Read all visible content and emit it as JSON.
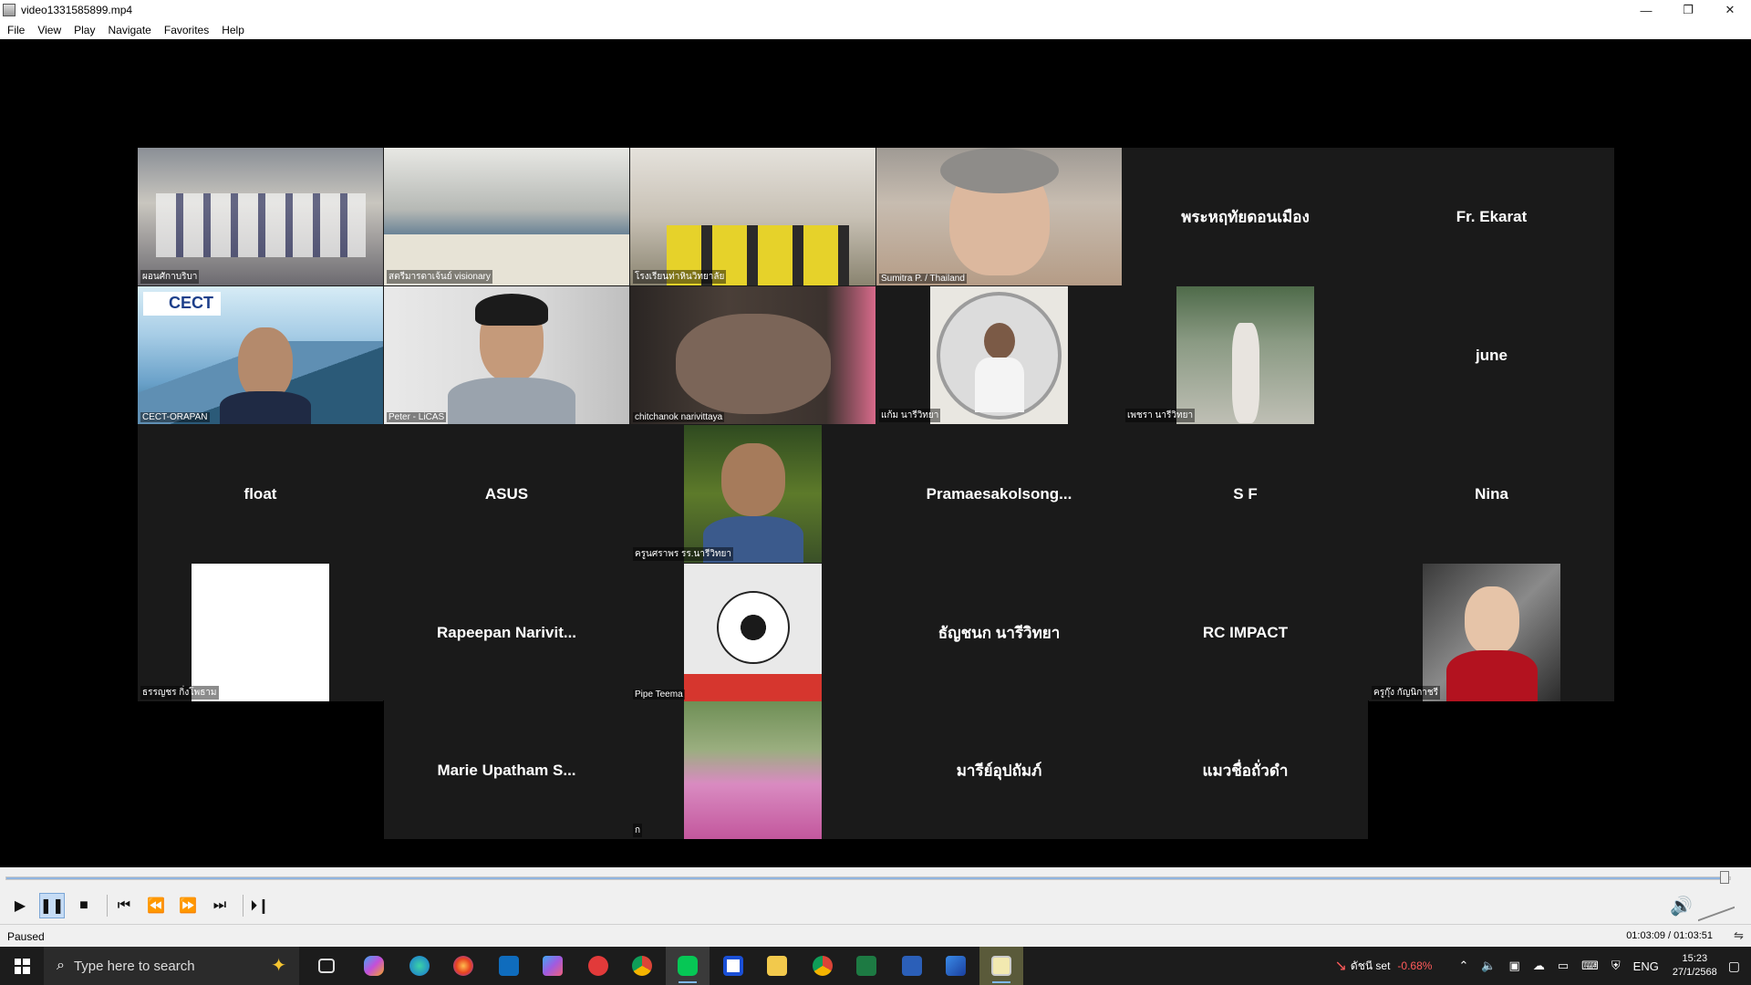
{
  "window": {
    "title": "video1331585899.mp4",
    "controls": {
      "minimize": "—",
      "restore": "❐",
      "close": "✕"
    }
  },
  "menu": [
    "File",
    "View",
    "Play",
    "Navigate",
    "Favorites",
    "Help"
  ],
  "participants": {
    "r0c0": "ผอนศักาบริบา",
    "r0c1": "สตรีมารดาเจ้นย์ visionary",
    "r0c2": "โรงเรียนท่าหินวิทยาลัย",
    "r0c3": "Sumitra P. / Thailand",
    "r0c4": "พระหฤทัยดอนเมือง",
    "r0c5": "Fr. Ekarat",
    "r1c0": "CECT-ORAPAN",
    "r1c0_logo": "CECT",
    "r1c1": "Peter - LiCAS",
    "r1c2": "chitchanok narivittaya",
    "r1c3": "แก้ม นารีวิทยา",
    "r1c4": "เพชรา นารีวิทยา",
    "r1c5": "june",
    "r2c0": "float",
    "r2c1": "ASUS",
    "r2c2": "ครูนศราพร รร.นารีวิทยา",
    "r2c3": "Pramaesakolsong...",
    "r2c4": "S F",
    "r2c5": "Nina",
    "r3c0": "ธรรญชร กิ่งโพธาม",
    "r3c1": "Rapeepan Narivit...",
    "r3c2": "Pipe Teema",
    "r3c3": "ธัญชนก นารีวิทยา",
    "r3c4": "RC IMPACT",
    "r3c5": "ครูกุ๊ง กัญนิกาชรี",
    "r4c1": "Marie Upatham S...",
    "r4c2": "ก",
    "r4c3": "มารีย์อุปถัมภ์",
    "r4c4": "แมวชื่อถั่วดำ"
  },
  "player": {
    "progress_fraction": 0.998,
    "buttons": {
      "play": "▶",
      "pause": "❚❚",
      "stop": "■",
      "prev": "⏮",
      "rewind": "⏪",
      "forward": "⏩",
      "next": "⏭",
      "frame": "⏵❙"
    },
    "volume_icon": "🔊"
  },
  "status": {
    "state": "Paused",
    "time": "01:03:09 / 01:03:51",
    "toggle": "⇋"
  },
  "taskbar": {
    "search_placeholder": "Type here to search",
    "stock_name": "ดัชนี set",
    "stock_change": "-0.68%",
    "lang": "ENG",
    "time": "15:23",
    "date": "27/1/2568"
  },
  "colors": {
    "tile_bg": "#1a1a1a",
    "accent": "#7fb8f0",
    "stock_down": "#ff5a5a"
  }
}
